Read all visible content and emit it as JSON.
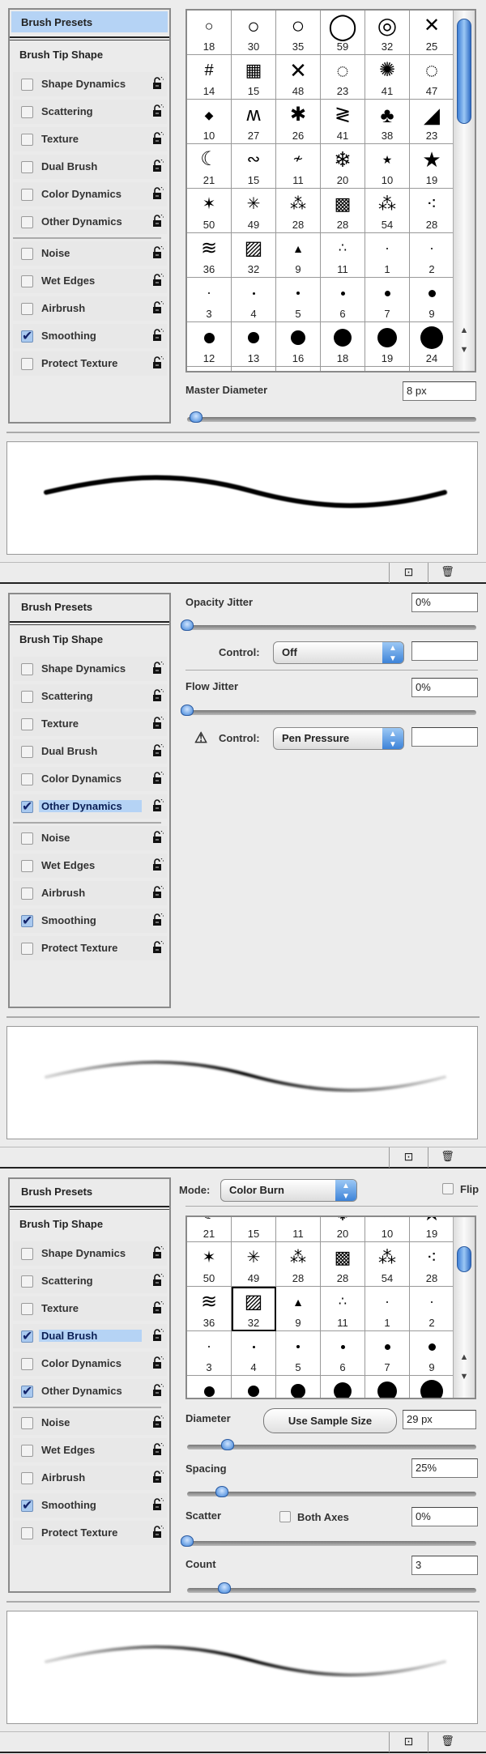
{
  "colors": {
    "selection": "#b5d3f5",
    "accent": "#3d83d8"
  },
  "list": {
    "presets": "Brush Presets",
    "tip": "Brush Tip Shape",
    "group1": [
      "Shape Dynamics",
      "Scattering",
      "Texture",
      "Dual Brush",
      "Color Dynamics",
      "Other Dynamics"
    ],
    "group2": [
      "Noise",
      "Wet Edges",
      "Airbrush",
      "Smoothing",
      "Protect Texture"
    ]
  },
  "brushes": [
    [
      {
        "n": "18",
        "i": "ring",
        "s": 18
      },
      {
        "n": "30",
        "i": "ring",
        "s": 26
      },
      {
        "n": "35",
        "i": "ring",
        "s": 28
      },
      {
        "n": "59",
        "i": "ring-bold",
        "s": 32
      },
      {
        "n": "32",
        "i": "double-ring",
        "s": 28
      },
      {
        "n": "25",
        "i": "x-thin",
        "s": 24
      }
    ],
    [
      {
        "n": "14",
        "i": "hatch",
        "s": 20
      },
      {
        "n": "15",
        "i": "grid",
        "s": 22
      },
      {
        "n": "48",
        "i": "x-thin",
        "s": 26
      },
      {
        "n": "23",
        "i": "dotted-ring",
        "s": 26
      },
      {
        "n": "41",
        "i": "swirl",
        "s": 24
      },
      {
        "n": "47",
        "i": "dotted-ring",
        "s": 28
      }
    ],
    [
      {
        "n": "10",
        "i": "diamond",
        "s": 14
      },
      {
        "n": "27",
        "i": "zigzag",
        "s": 24
      },
      {
        "n": "26",
        "i": "splat",
        "s": 24
      },
      {
        "n": "41",
        "i": "chevron",
        "s": 24
      },
      {
        "n": "38",
        "i": "leaf",
        "s": 26
      },
      {
        "n": "23",
        "i": "wedge",
        "s": 26
      }
    ],
    [
      {
        "n": "21",
        "i": "crescent",
        "s": 24
      },
      {
        "n": "15",
        "i": "squiggle",
        "s": 20
      },
      {
        "n": "11",
        "i": "twig",
        "s": 16
      },
      {
        "n": "20",
        "i": "snowflake",
        "s": 26
      },
      {
        "n": "10",
        "i": "star",
        "s": 14
      },
      {
        "n": "19",
        "i": "star",
        "s": 26
      }
    ],
    [
      {
        "n": "50",
        "i": "spark",
        "s": 20
      },
      {
        "n": "49",
        "i": "spark-light",
        "s": 20
      },
      {
        "n": "28",
        "i": "spray",
        "s": 20
      },
      {
        "n": "28",
        "i": "texture",
        "s": 22
      },
      {
        "n": "54",
        "i": "spray",
        "s": 22
      },
      {
        "n": "28",
        "i": "scatter",
        "s": 22
      }
    ],
    [
      {
        "n": "36",
        "i": "grass",
        "s": 24
      },
      {
        "n": "32",
        "i": "charcoal",
        "s": 24
      },
      {
        "n": "9",
        "i": "triangle",
        "s": 14
      },
      {
        "n": "11",
        "i": "dots",
        "s": 16
      },
      {
        "n": "1",
        "i": "dot",
        "s": 2
      },
      {
        "n": "2",
        "i": "dot",
        "s": 2
      }
    ],
    [
      {
        "n": "3",
        "i": "dot",
        "s": 2
      },
      {
        "n": "4",
        "i": "dot",
        "s": 3
      },
      {
        "n": "5",
        "i": "dot",
        "s": 4
      },
      {
        "n": "6",
        "i": "dot",
        "s": 5
      },
      {
        "n": "7",
        "i": "dot",
        "s": 7
      },
      {
        "n": "9",
        "i": "dot",
        "s": 9
      }
    ],
    [
      {
        "n": "12",
        "i": "dot",
        "s": 13
      },
      {
        "n": "13",
        "i": "dot",
        "s": 14
      },
      {
        "n": "16",
        "i": "dot",
        "s": 18
      },
      {
        "n": "18",
        "i": "dot",
        "s": 22
      },
      {
        "n": "19",
        "i": "dot",
        "s": 24
      },
      {
        "n": "24",
        "i": "dot",
        "s": 28
      }
    ],
    [
      {
        "n": "",
        "i": "dot",
        "s": 26
      },
      {
        "n": "",
        "i": "dot",
        "s": 26
      },
      {
        "n": "",
        "i": "dot",
        "s": 26
      },
      {
        "n": "",
        "i": "dot",
        "s": 26
      },
      {
        "n": "",
        "i": "dot",
        "s": 26
      },
      {
        "n": "",
        "i": "dot",
        "s": 26
      }
    ]
  ],
  "panels": [
    {
      "selected": "presets",
      "checked": [
        "Smoothing"
      ],
      "master_diameter": {
        "label": "Master Diameter",
        "value": "8 px",
        "slider": 0.03
      }
    },
    {
      "selected": "Other Dynamics",
      "checked": [
        "Other Dynamics",
        "Smoothing"
      ],
      "opacity_jitter": {
        "label": "Opacity Jitter",
        "value": "0%",
        "slider": 0,
        "control_label": "Control:",
        "control_value": "Off",
        "extra": ""
      },
      "flow_jitter": {
        "label": "Flow Jitter",
        "value": "0%",
        "slider": 0,
        "control_label": "Control:",
        "control_value": "Pen Pressure",
        "extra": "",
        "warning_icon": "warning-triangle"
      }
    },
    {
      "selected": "Dual Brush",
      "checked": [
        "Dual Brush",
        "Other Dynamics",
        "Smoothing"
      ],
      "mode": {
        "label": "Mode:",
        "value": "Color Burn"
      },
      "flip": {
        "label": "Flip",
        "checked": false
      },
      "selected_brush": "32",
      "diameter": {
        "label": "Diameter",
        "button": "Use Sample Size",
        "value": "29 px",
        "slider": 0.14
      },
      "spacing": {
        "label": "Spacing",
        "value": "25%",
        "slider": 0.12
      },
      "scatter": {
        "label": "Scatter",
        "both_axes": "Both Axes",
        "both_axes_checked": false,
        "value": "0%",
        "slider": 0
      },
      "count": {
        "label": "Count",
        "value": "3",
        "slider": 0.13
      }
    }
  ],
  "bottom_bar": {
    "new_icon": "new-preset-icon",
    "trash_icon": "trash-icon"
  }
}
